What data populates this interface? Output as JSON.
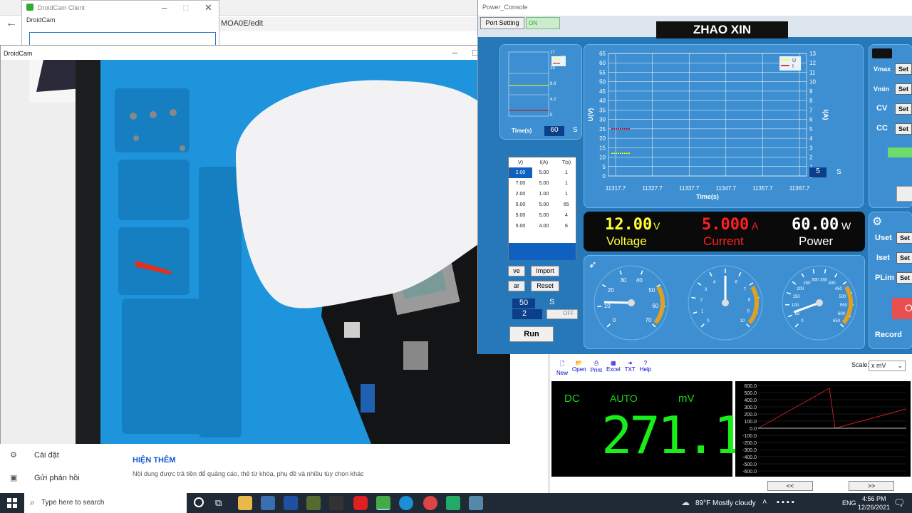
{
  "browser": {
    "url": "MOA0E/edit",
    "settings_label": "Cài đặt",
    "feedback_label": "Gửi phản hồi",
    "more_label": "HIỆN THÊM",
    "more_desc": "Nội dung được trả tiền để quảng cáo, thẻ từ khóa, phụ đề và nhiều tùy chọn khác"
  },
  "droidcam_client": {
    "title": "DroidCam Client",
    "menu": "DroidCam"
  },
  "droidcam_window": {
    "title": "DroidCam"
  },
  "power_console": {
    "title": "Power_Console",
    "port_setting": "Port Setting",
    "toggle": "ON",
    "brand": "ZHAO XIN",
    "left_chart": {
      "time_label": "Time(s)",
      "time_value": "60",
      "unit": "S",
      "right_ticks": [
        "17",
        "13",
        "8.8",
        "4.2",
        "0"
      ],
      "legend": [
        "U",
        "I"
      ]
    },
    "main_chart": {
      "type": "line",
      "ylabel_left": "U(V)",
      "ylabel_right": "I(A)",
      "xlabel": "Time(s)",
      "y_left_ticks": [
        "65",
        "60",
        "55",
        "50",
        "45",
        "40",
        "35",
        "30",
        "25",
        "20",
        "15",
        "10",
        "5",
        "0"
      ],
      "y_right_ticks": [
        "13",
        "12",
        "11",
        "10",
        "9",
        "8",
        "7",
        "6",
        "5",
        "4",
        "3",
        "2",
        "1",
        "0"
      ],
      "x_ticks": [
        "11317.7",
        "11327.7",
        "11337.7",
        "11347.7",
        "11357.7",
        "11367.7"
      ],
      "legend": [
        "U",
        "I"
      ],
      "series": [
        {
          "name": "U",
          "color": "#ffff00",
          "y": 12
        },
        {
          "name": "I",
          "color": "#cc0000",
          "y": 5
        }
      ],
      "span_value": "5",
      "span_unit": "S"
    },
    "table": {
      "headers": [
        "V)",
        "I(A)",
        "T(s)"
      ],
      "rows": [
        [
          "2.00",
          "5.00",
          "1"
        ],
        [
          "7.00",
          "5.00",
          "1"
        ],
        [
          "2.00",
          "1.00",
          "1"
        ],
        [
          "5.00",
          "5.00",
          "65"
        ],
        [
          "5.00",
          "5.00",
          "4"
        ],
        [
          "5.00",
          "4.00",
          "6"
        ]
      ]
    },
    "buttons": {
      "import": "Import",
      "reset": "Reset",
      "ve": "ve",
      "ar": "ar",
      "run": "Run",
      "off": "OFF"
    },
    "spin1": {
      "value": "50",
      "unit": "S"
    },
    "spin2": {
      "value": "2"
    },
    "readouts": [
      {
        "value": "12.00",
        "unit": "V",
        "label": "Voltage",
        "color": "#ffff33"
      },
      {
        "value": "5.000",
        "unit": "A",
        "label": "Current",
        "color": "#ff2020"
      },
      {
        "value": "60.00",
        "unit": "W",
        "label": "Power",
        "color": "#ffffff"
      }
    ],
    "gauges": [
      {
        "ticks": [
          "0",
          "10",
          "20",
          "30",
          "40",
          "50",
          "60",
          "70"
        ],
        "value": 12,
        "max": 70
      },
      {
        "ticks": [
          "0",
          "1",
          "2",
          "3",
          "4",
          "5",
          "6",
          "7",
          "8",
          "9",
          "10"
        ],
        "value": 5,
        "max": 10
      },
      {
        "ticks": [
          "0",
          "50",
          "100",
          "150",
          "200",
          "250",
          "300",
          "350",
          "400",
          "450",
          "500",
          "550",
          "600",
          "650"
        ],
        "value": 60,
        "max": 650
      }
    ],
    "right_labels": {
      "vmax": "Vmax",
      "vmin": "Vmin",
      "cv": "CV",
      "cc": "CC",
      "uset": "Uset",
      "iset": "Iset",
      "plim": "PLim",
      "record": "Record",
      "set": "Set",
      "on": "O"
    }
  },
  "multimeter": {
    "tools": [
      "New",
      "Open",
      "Print",
      "Excel",
      "TXT",
      "Help"
    ],
    "scale_label": "Scale:",
    "scale_value": "x mV",
    "mode": "DC",
    "range": "AUTO",
    "unit": "mV",
    "reading": "271.1",
    "chart": {
      "type": "line",
      "y_ticks": [
        "600.0",
        "500.0",
        "400.0",
        "300.0",
        "200.0",
        "100.0",
        "0.0",
        "-100.0",
        "-200.0",
        "-300.0",
        "-400.0",
        "-500.0",
        "-600.0"
      ]
    },
    "nav_prev": "<<",
    "nav_next": ">>"
  },
  "taskbar": {
    "search_placeholder": "Type here to search",
    "weather": "89°F  Mostly cloudy",
    "lang": "ENG",
    "time": "4:56 PM",
    "date": "12/26/2021"
  }
}
